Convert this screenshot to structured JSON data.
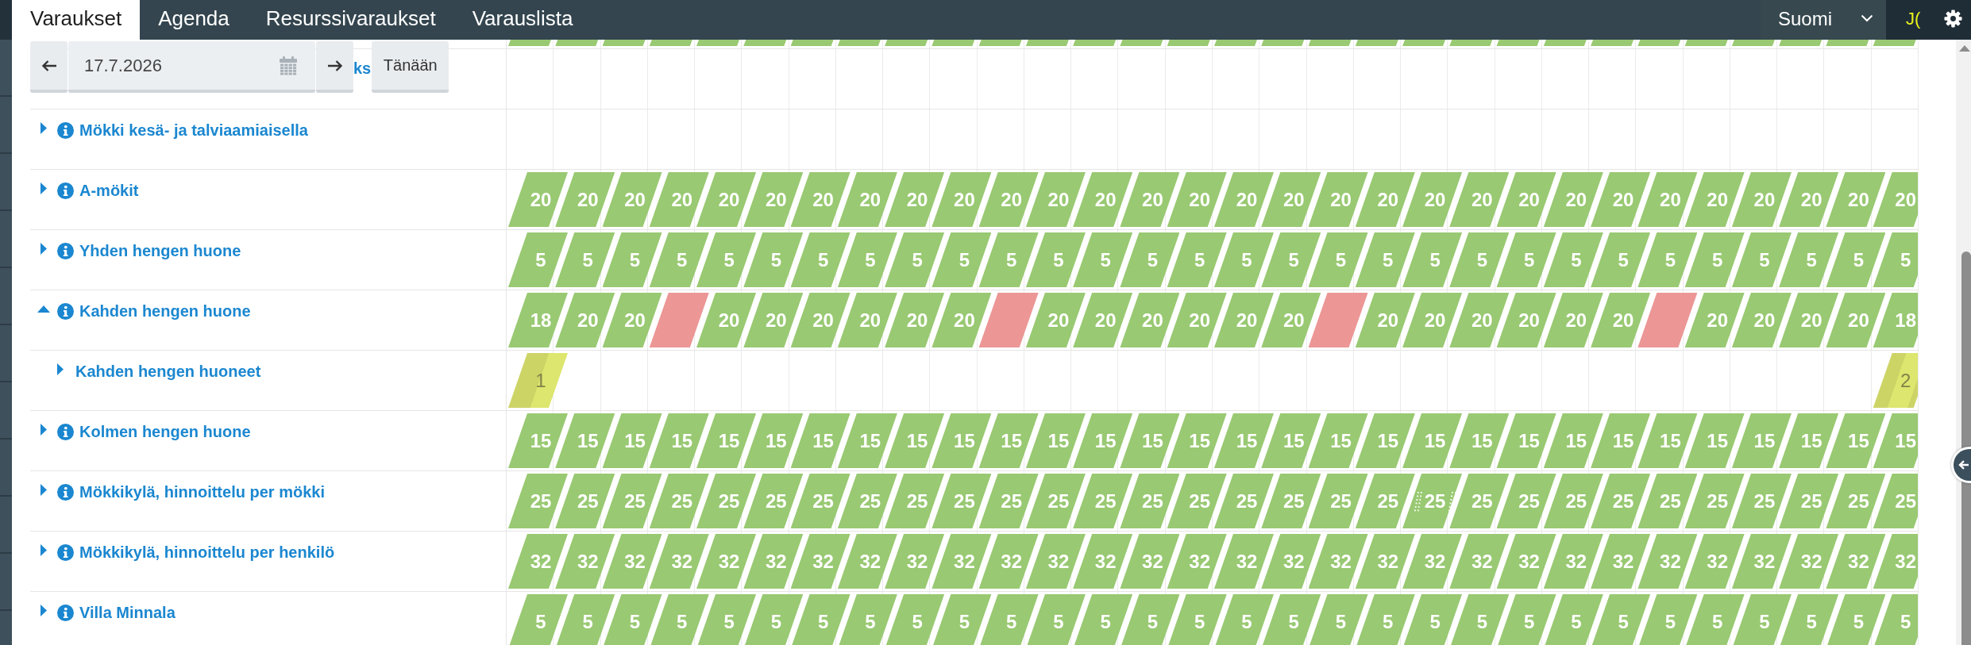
{
  "tabs": [
    {
      "label": "Varaukset",
      "selected": true
    },
    {
      "label": "Agenda",
      "selected": false
    },
    {
      "label": "Resurssivaraukset",
      "selected": false
    },
    {
      "label": "Varauslista",
      "selected": false
    }
  ],
  "language_select": {
    "value": "Suomi"
  },
  "user": {
    "initials": "J("
  },
  "date_nav": {
    "date": "17.7.2026",
    "today_button": "Tänään"
  },
  "clipped_row": {
    "cells": [
      {
        "kind": "open"
      },
      {
        "kind": "open"
      },
      {
        "kind": "open"
      },
      {
        "kind": "open"
      },
      {
        "kind": "open"
      },
      {
        "kind": "open"
      },
      {
        "kind": "open"
      },
      {
        "kind": "open"
      },
      {
        "kind": "open"
      },
      {
        "kind": "open"
      },
      {
        "kind": "open"
      },
      {
        "kind": "open"
      },
      {
        "kind": "open"
      },
      {
        "kind": "open"
      },
      {
        "kind": "open"
      },
      {
        "kind": "open"
      },
      {
        "kind": "open"
      },
      {
        "kind": "open"
      },
      {
        "kind": "open"
      },
      {
        "kind": "open"
      },
      {
        "kind": "open"
      },
      {
        "kind": "open"
      },
      {
        "kind": "open"
      },
      {
        "kind": "open"
      },
      {
        "kind": "open"
      },
      {
        "kind": "open"
      },
      {
        "kind": "open"
      },
      {
        "kind": "open"
      },
      {
        "kind": "open"
      },
      {
        "kind": "open"
      }
    ]
  },
  "covered_row": {
    "label": "ks"
  },
  "rows": [
    {
      "label": "Mökki kesä- ja talviaamiaisella",
      "expanded": false
    },
    {
      "label": "A-mökit",
      "expanded": false,
      "cells": [
        {
          "kind": "open",
          "value": "20"
        },
        {
          "kind": "open",
          "value": "20"
        },
        {
          "kind": "open",
          "value": "20"
        },
        {
          "kind": "open",
          "value": "20"
        },
        {
          "kind": "open",
          "value": "20"
        },
        {
          "kind": "open",
          "value": "20"
        },
        {
          "kind": "open",
          "value": "20"
        },
        {
          "kind": "open",
          "value": "20"
        },
        {
          "kind": "open",
          "value": "20"
        },
        {
          "kind": "open",
          "value": "20"
        },
        {
          "kind": "open",
          "value": "20"
        },
        {
          "kind": "open",
          "value": "20"
        },
        {
          "kind": "open",
          "value": "20"
        },
        {
          "kind": "open",
          "value": "20"
        },
        {
          "kind": "open",
          "value": "20"
        },
        {
          "kind": "open",
          "value": "20"
        },
        {
          "kind": "open",
          "value": "20"
        },
        {
          "kind": "open",
          "value": "20"
        },
        {
          "kind": "open",
          "value": "20"
        },
        {
          "kind": "open",
          "value": "20"
        },
        {
          "kind": "open",
          "value": "20"
        },
        {
          "kind": "open",
          "value": "20"
        },
        {
          "kind": "open",
          "value": "20"
        },
        {
          "kind": "open",
          "value": "20"
        },
        {
          "kind": "open",
          "value": "20"
        },
        {
          "kind": "open",
          "value": "20"
        },
        {
          "kind": "open",
          "value": "20"
        },
        {
          "kind": "open",
          "value": "20"
        },
        {
          "kind": "open",
          "value": "20"
        },
        {
          "kind": "open",
          "value": "20"
        }
      ]
    },
    {
      "label": "Yhden hengen huone",
      "expanded": false,
      "cells": [
        {
          "kind": "open",
          "value": "5"
        },
        {
          "kind": "open",
          "value": "5"
        },
        {
          "kind": "open",
          "value": "5"
        },
        {
          "kind": "open",
          "value": "5"
        },
        {
          "kind": "open",
          "value": "5"
        },
        {
          "kind": "open",
          "value": "5"
        },
        {
          "kind": "open",
          "value": "5"
        },
        {
          "kind": "open",
          "value": "5"
        },
        {
          "kind": "open",
          "value": "5"
        },
        {
          "kind": "open",
          "value": "5"
        },
        {
          "kind": "open",
          "value": "5"
        },
        {
          "kind": "open",
          "value": "5"
        },
        {
          "kind": "open",
          "value": "5"
        },
        {
          "kind": "open",
          "value": "5"
        },
        {
          "kind": "open",
          "value": "5"
        },
        {
          "kind": "open",
          "value": "5"
        },
        {
          "kind": "open",
          "value": "5"
        },
        {
          "kind": "open",
          "value": "5"
        },
        {
          "kind": "open",
          "value": "5"
        },
        {
          "kind": "open",
          "value": "5"
        },
        {
          "kind": "open",
          "value": "5"
        },
        {
          "kind": "open",
          "value": "5"
        },
        {
          "kind": "open",
          "value": "5"
        },
        {
          "kind": "open",
          "value": "5"
        },
        {
          "kind": "open",
          "value": "5"
        },
        {
          "kind": "open",
          "value": "5"
        },
        {
          "kind": "open",
          "value": "5"
        },
        {
          "kind": "open",
          "value": "5"
        },
        {
          "kind": "open",
          "value": "5"
        },
        {
          "kind": "open",
          "value": "5"
        }
      ]
    },
    {
      "label": "Kahden hengen huone",
      "expanded": true,
      "cells": [
        {
          "kind": "open",
          "value": "18"
        },
        {
          "kind": "open",
          "value": "20"
        },
        {
          "kind": "open",
          "value": "20"
        },
        {
          "kind": "full"
        },
        {
          "kind": "open",
          "value": "20"
        },
        {
          "kind": "open",
          "value": "20"
        },
        {
          "kind": "open",
          "value": "20"
        },
        {
          "kind": "open",
          "value": "20"
        },
        {
          "kind": "open",
          "value": "20"
        },
        {
          "kind": "open",
          "value": "20"
        },
        {
          "kind": "full"
        },
        {
          "kind": "open",
          "value": "20"
        },
        {
          "kind": "open",
          "value": "20"
        },
        {
          "kind": "open",
          "value": "20"
        },
        {
          "kind": "open",
          "value": "20"
        },
        {
          "kind": "open",
          "value": "20"
        },
        {
          "kind": "open",
          "value": "20"
        },
        {
          "kind": "full"
        },
        {
          "kind": "open",
          "value": "20"
        },
        {
          "kind": "open",
          "value": "20"
        },
        {
          "kind": "open",
          "value": "20"
        },
        {
          "kind": "open",
          "value": "20"
        },
        {
          "kind": "open",
          "value": "20"
        },
        {
          "kind": "open",
          "value": "20"
        },
        {
          "kind": "full"
        },
        {
          "kind": "open",
          "value": "20"
        },
        {
          "kind": "open",
          "value": "20"
        },
        {
          "kind": "open",
          "value": "20"
        },
        {
          "kind": "open",
          "value": "20"
        },
        {
          "kind": "open",
          "value": "18"
        }
      ],
      "children": [
        {
          "label": "Kahden hengen huoneet",
          "expanded": false,
          "cells": [
            {
              "kind": "booked",
              "value": "1"
            },
            {
              "kind": "empty"
            },
            {
              "kind": "empty"
            },
            {
              "kind": "empty"
            },
            {
              "kind": "empty"
            },
            {
              "kind": "empty"
            },
            {
              "kind": "empty"
            },
            {
              "kind": "empty"
            },
            {
              "kind": "empty"
            },
            {
              "kind": "empty"
            },
            {
              "kind": "empty"
            },
            {
              "kind": "empty"
            },
            {
              "kind": "empty"
            },
            {
              "kind": "empty"
            },
            {
              "kind": "empty"
            },
            {
              "kind": "empty"
            },
            {
              "kind": "empty"
            },
            {
              "kind": "empty"
            },
            {
              "kind": "empty"
            },
            {
              "kind": "empty"
            },
            {
              "kind": "empty"
            },
            {
              "kind": "empty"
            },
            {
              "kind": "empty"
            },
            {
              "kind": "empty"
            },
            {
              "kind": "empty"
            },
            {
              "kind": "empty"
            },
            {
              "kind": "empty"
            },
            {
              "kind": "empty"
            },
            {
              "kind": "empty"
            },
            {
              "kind": "booked",
              "value": "2"
            }
          ]
        }
      ]
    },
    {
      "label": "Kolmen hengen huone",
      "expanded": false,
      "cells": [
        {
          "kind": "open",
          "value": "15"
        },
        {
          "kind": "open",
          "value": "15"
        },
        {
          "kind": "open",
          "value": "15"
        },
        {
          "kind": "open",
          "value": "15"
        },
        {
          "kind": "open",
          "value": "15"
        },
        {
          "kind": "open",
          "value": "15"
        },
        {
          "kind": "open",
          "value": "15"
        },
        {
          "kind": "open",
          "value": "15"
        },
        {
          "kind": "open",
          "value": "15"
        },
        {
          "kind": "open",
          "value": "15"
        },
        {
          "kind": "open",
          "value": "15"
        },
        {
          "kind": "open",
          "value": "15"
        },
        {
          "kind": "open",
          "value": "15"
        },
        {
          "kind": "open",
          "value": "15"
        },
        {
          "kind": "open",
          "value": "15"
        },
        {
          "kind": "open",
          "value": "15"
        },
        {
          "kind": "open",
          "value": "15"
        },
        {
          "kind": "open",
          "value": "15"
        },
        {
          "kind": "open",
          "value": "15"
        },
        {
          "kind": "open",
          "value": "15"
        },
        {
          "kind": "open",
          "value": "15"
        },
        {
          "kind": "open",
          "value": "15"
        },
        {
          "kind": "open",
          "value": "15"
        },
        {
          "kind": "open",
          "value": "15"
        },
        {
          "kind": "open",
          "value": "15"
        },
        {
          "kind": "open",
          "value": "15"
        },
        {
          "kind": "open",
          "value": "15"
        },
        {
          "kind": "open",
          "value": "15"
        },
        {
          "kind": "open",
          "value": "15"
        },
        {
          "kind": "open",
          "value": "15"
        }
      ]
    },
    {
      "label": "Mökkikylä, hinnoittelu per mökki",
      "expanded": false,
      "cells": [
        {
          "kind": "open",
          "value": "25"
        },
        {
          "kind": "open",
          "value": "25"
        },
        {
          "kind": "open",
          "value": "25"
        },
        {
          "kind": "open",
          "value": "25"
        },
        {
          "kind": "open",
          "value": "25"
        },
        {
          "kind": "open",
          "value": "25"
        },
        {
          "kind": "open",
          "value": "25"
        },
        {
          "kind": "open",
          "value": "25"
        },
        {
          "kind": "open",
          "value": "25"
        },
        {
          "kind": "open",
          "value": "25"
        },
        {
          "kind": "open",
          "value": "25"
        },
        {
          "kind": "open",
          "value": "25"
        },
        {
          "kind": "open",
          "value": "25"
        },
        {
          "kind": "open",
          "value": "25"
        },
        {
          "kind": "open",
          "value": "25"
        },
        {
          "kind": "open",
          "value": "25"
        },
        {
          "kind": "open",
          "value": "25"
        },
        {
          "kind": "open",
          "value": "25"
        },
        {
          "kind": "open",
          "value": "25"
        },
        {
          "kind": "hover",
          "value": "25"
        },
        {
          "kind": "open",
          "value": "25"
        },
        {
          "kind": "open",
          "value": "25"
        },
        {
          "kind": "open",
          "value": "25"
        },
        {
          "kind": "open",
          "value": "25"
        },
        {
          "kind": "open",
          "value": "25"
        },
        {
          "kind": "open",
          "value": "25"
        },
        {
          "kind": "open",
          "value": "25"
        },
        {
          "kind": "open",
          "value": "25"
        },
        {
          "kind": "open",
          "value": "25"
        },
        {
          "kind": "open",
          "value": "25"
        }
      ]
    },
    {
      "label": "Mökkikylä, hinnoittelu per henkilö",
      "expanded": false,
      "cells": [
        {
          "kind": "open",
          "value": "32"
        },
        {
          "kind": "open",
          "value": "32"
        },
        {
          "kind": "open",
          "value": "32"
        },
        {
          "kind": "open",
          "value": "32"
        },
        {
          "kind": "open",
          "value": "32"
        },
        {
          "kind": "open",
          "value": "32"
        },
        {
          "kind": "open",
          "value": "32"
        },
        {
          "kind": "open",
          "value": "32"
        },
        {
          "kind": "open",
          "value": "32"
        },
        {
          "kind": "open",
          "value": "32"
        },
        {
          "kind": "open",
          "value": "32"
        },
        {
          "kind": "open",
          "value": "32"
        },
        {
          "kind": "open",
          "value": "32"
        },
        {
          "kind": "open",
          "value": "32"
        },
        {
          "kind": "open",
          "value": "32"
        },
        {
          "kind": "open",
          "value": "32"
        },
        {
          "kind": "open",
          "value": "32"
        },
        {
          "kind": "open",
          "value": "32"
        },
        {
          "kind": "open",
          "value": "32"
        },
        {
          "kind": "open",
          "value": "32"
        },
        {
          "kind": "open",
          "value": "32"
        },
        {
          "kind": "open",
          "value": "32"
        },
        {
          "kind": "open",
          "value": "32"
        },
        {
          "kind": "open",
          "value": "32"
        },
        {
          "kind": "open",
          "value": "32"
        },
        {
          "kind": "open",
          "value": "32"
        },
        {
          "kind": "open",
          "value": "32"
        },
        {
          "kind": "open",
          "value": "32"
        },
        {
          "kind": "open",
          "value": "32"
        },
        {
          "kind": "open",
          "value": "32"
        }
      ]
    },
    {
      "label": "Villa Minnala",
      "expanded": false,
      "cells": [
        {
          "kind": "open",
          "value": "5"
        },
        {
          "kind": "open",
          "value": "5"
        },
        {
          "kind": "open",
          "value": "5"
        },
        {
          "kind": "open",
          "value": "5"
        },
        {
          "kind": "open",
          "value": "5"
        },
        {
          "kind": "open",
          "value": "5"
        },
        {
          "kind": "open",
          "value": "5"
        },
        {
          "kind": "open",
          "value": "5"
        },
        {
          "kind": "open",
          "value": "5"
        },
        {
          "kind": "open",
          "value": "5"
        },
        {
          "kind": "open",
          "value": "5"
        },
        {
          "kind": "open",
          "value": "5"
        },
        {
          "kind": "open",
          "value": "5"
        },
        {
          "kind": "open",
          "value": "5"
        },
        {
          "kind": "open",
          "value": "5"
        },
        {
          "kind": "open",
          "value": "5"
        },
        {
          "kind": "open",
          "value": "5"
        },
        {
          "kind": "open",
          "value": "5"
        },
        {
          "kind": "open",
          "value": "5"
        },
        {
          "kind": "open",
          "value": "5"
        },
        {
          "kind": "open",
          "value": "5"
        },
        {
          "kind": "open",
          "value": "5"
        },
        {
          "kind": "open",
          "value": "5"
        },
        {
          "kind": "open",
          "value": "5"
        },
        {
          "kind": "open",
          "value": "5"
        },
        {
          "kind": "open",
          "value": "5"
        },
        {
          "kind": "open",
          "value": "5"
        },
        {
          "kind": "open",
          "value": "5"
        },
        {
          "kind": "open",
          "value": "5"
        },
        {
          "kind": "open",
          "value": "5"
        }
      ]
    }
  ]
}
